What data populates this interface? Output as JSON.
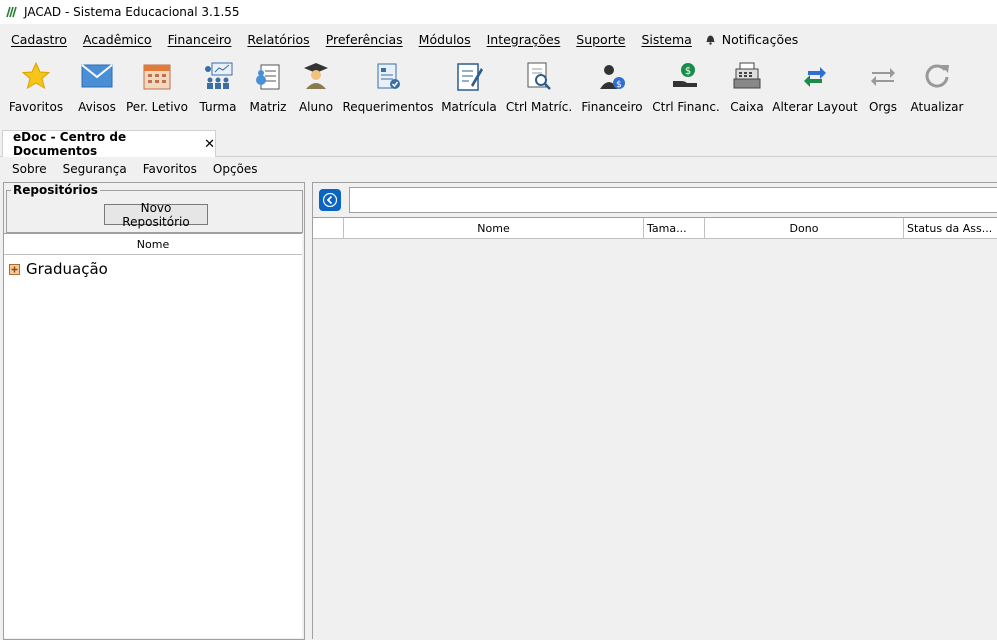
{
  "window": {
    "title": "JACAD - Sistema Educacional 3.1.55"
  },
  "menu": {
    "items": [
      "Cadastro",
      "Acadêmico",
      "Financeiro",
      "Relatórios",
      "Preferências",
      "Módulos",
      "Integrações",
      "Suporte",
      "Sistema"
    ],
    "notifications_label": "Notificações"
  },
  "toolbar": {
    "items": [
      "Favoritos",
      "Avisos",
      "Per. Letivo",
      "Turma",
      "Matriz",
      "Aluno",
      "Requerimentos",
      "Matrícula",
      "Ctrl Matríc.",
      "Financeiro",
      "Ctrl Financ.",
      "Caixa",
      "Alterar Layout",
      "Orgs",
      "Atualizar"
    ]
  },
  "tab": {
    "label": "eDoc - Centro de Documentos",
    "close": "✕"
  },
  "submenu": {
    "items": [
      "Sobre",
      "Segurança",
      "Favoritos",
      "Opções"
    ]
  },
  "repositories": {
    "legend": "Repositórios",
    "new_button": "Novo Repositório",
    "column": "Nome",
    "tree": [
      {
        "label": "Graduação"
      }
    ]
  },
  "files": {
    "path_value": "",
    "columns": [
      "",
      "Nome",
      "Tama...",
      "Dono",
      "Status da Ass..."
    ]
  },
  "colors": {
    "accent": "#0b64c0",
    "star": "#f5c518",
    "envelope": "#4a8fd6"
  }
}
